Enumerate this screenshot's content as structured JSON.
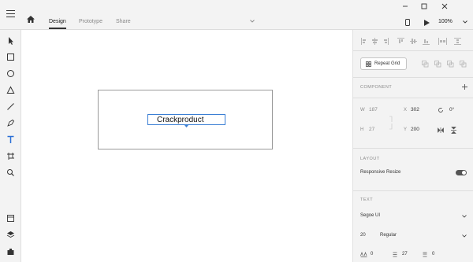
{
  "tabs": [
    {
      "label": "Design",
      "active": true
    },
    {
      "label": "Prototype",
      "active": false
    },
    {
      "label": "Share",
      "active": false
    }
  ],
  "zoom": "100%",
  "canvas": {
    "text_value": "Crackproduct"
  },
  "repeat_grid": {
    "label": "Repeat Grid"
  },
  "component": {
    "header": "COMPONENT",
    "add_icon": "plus-icon"
  },
  "transform": {
    "w_label": "W",
    "w_value": "187",
    "h_label": "H",
    "h_value": "27",
    "x_label": "X",
    "x_value": "302",
    "y_label": "Y",
    "y_value": "200",
    "rotation": "0°"
  },
  "layout": {
    "header": "LAYOUT",
    "responsive_label": "Responsive Resize",
    "responsive_on": true
  },
  "text": {
    "header": "TEXT",
    "font_family": "Segoe UI",
    "font_size": "20",
    "font_weight": "Regular",
    "char_spacing": "0",
    "line_spacing": "27",
    "para_spacing": "0"
  },
  "colors": {
    "accent_selection": "#3b7fd4",
    "toggle_on": "#555555"
  }
}
